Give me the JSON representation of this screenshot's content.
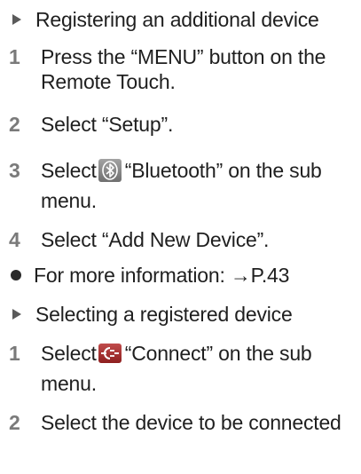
{
  "section1": {
    "heading": "Registering an additional device",
    "steps": [
      {
        "num": "1",
        "line1": "Press the “MENU” button on the",
        "line2": "Remote Touch."
      },
      {
        "num": "2",
        "text": "Select “Setup”."
      },
      {
        "num": "3",
        "before": "Select",
        "after": "“Bluetooth” on the sub",
        "line2": "menu.",
        "icon": "bluetooth-icon"
      },
      {
        "num": "4",
        "text": "Select “Add New Device”."
      }
    ],
    "note": "For more information: →P.43"
  },
  "section2": {
    "heading": "Selecting a registered device",
    "steps": [
      {
        "num": "1",
        "before": "Select",
        "after": "“Connect” on the sub",
        "line2": "menu.",
        "icon": "connect-icon"
      },
      {
        "num": "2",
        "text": "Select the device to be connected"
      }
    ]
  },
  "colors": {
    "text": "#1f1f1f",
    "step_number": "#7a7a7a",
    "bluetooth_icon": "#8a8a8a",
    "connect_icon": "#b03030"
  }
}
